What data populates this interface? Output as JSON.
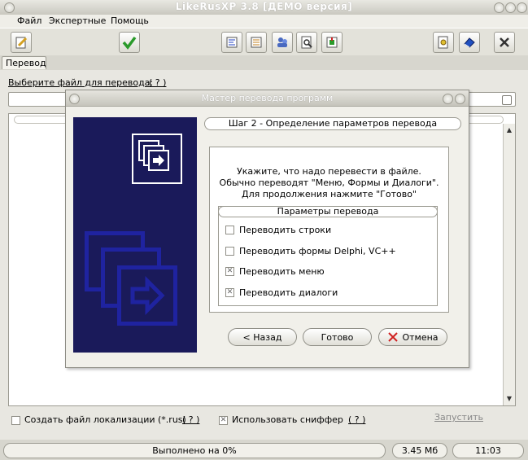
{
  "window": {
    "title": "LikeRusXP 3.8  [ДЕМО версия]"
  },
  "menu": [
    "Файл",
    "Экспертные",
    "Помощь"
  ],
  "toolbar": {
    "icons": [
      "edit-icon",
      "check-icon",
      "align-left-icon",
      "align-list-icon",
      "users-icon",
      "search-doc-icon",
      "export-icon",
      "properties-icon",
      "eraser-icon",
      "close-icon"
    ]
  },
  "tab": {
    "label": "Перевод"
  },
  "main": {
    "select_file_label": "Выберите файл для перевода:",
    "help_label": "( ? )",
    "file_value": "",
    "create_localization_label": "Создать файл локализации (*.rus)",
    "create_localization_checked": false,
    "use_sniffer_label": "Использовать сниффер",
    "use_sniffer_checked": true,
    "run_label": "Запустить"
  },
  "status": {
    "progress_text": "Выполнено на 0%",
    "size": "3.45 Мб",
    "time": "11:03"
  },
  "dialog": {
    "title": "Мастер перевода программ",
    "step": "Шаг 2 - Определение параметров перевода",
    "instructions": [
      "Укажите, что надо перевести в файле.",
      "Обычно переводят \"Меню, Формы и Диалоги\".",
      "Для продолжения нажмите \"Готово\""
    ],
    "params_title": "Параметры перевода",
    "options": [
      {
        "label": "Переводить строки",
        "checked": false
      },
      {
        "label": "Переводить формы Delphi, VC++",
        "checked": false
      },
      {
        "label": "Переводить меню",
        "checked": true
      },
      {
        "label": "Переводить диалоги",
        "checked": true
      }
    ],
    "buttons": {
      "back": "< Назад",
      "finish": "Готово",
      "cancel": "Отмена"
    }
  },
  "colors": {
    "banner": "#1a1a5a",
    "banner_frame": "#1f23a0",
    "cancel_x": "#d02020"
  }
}
